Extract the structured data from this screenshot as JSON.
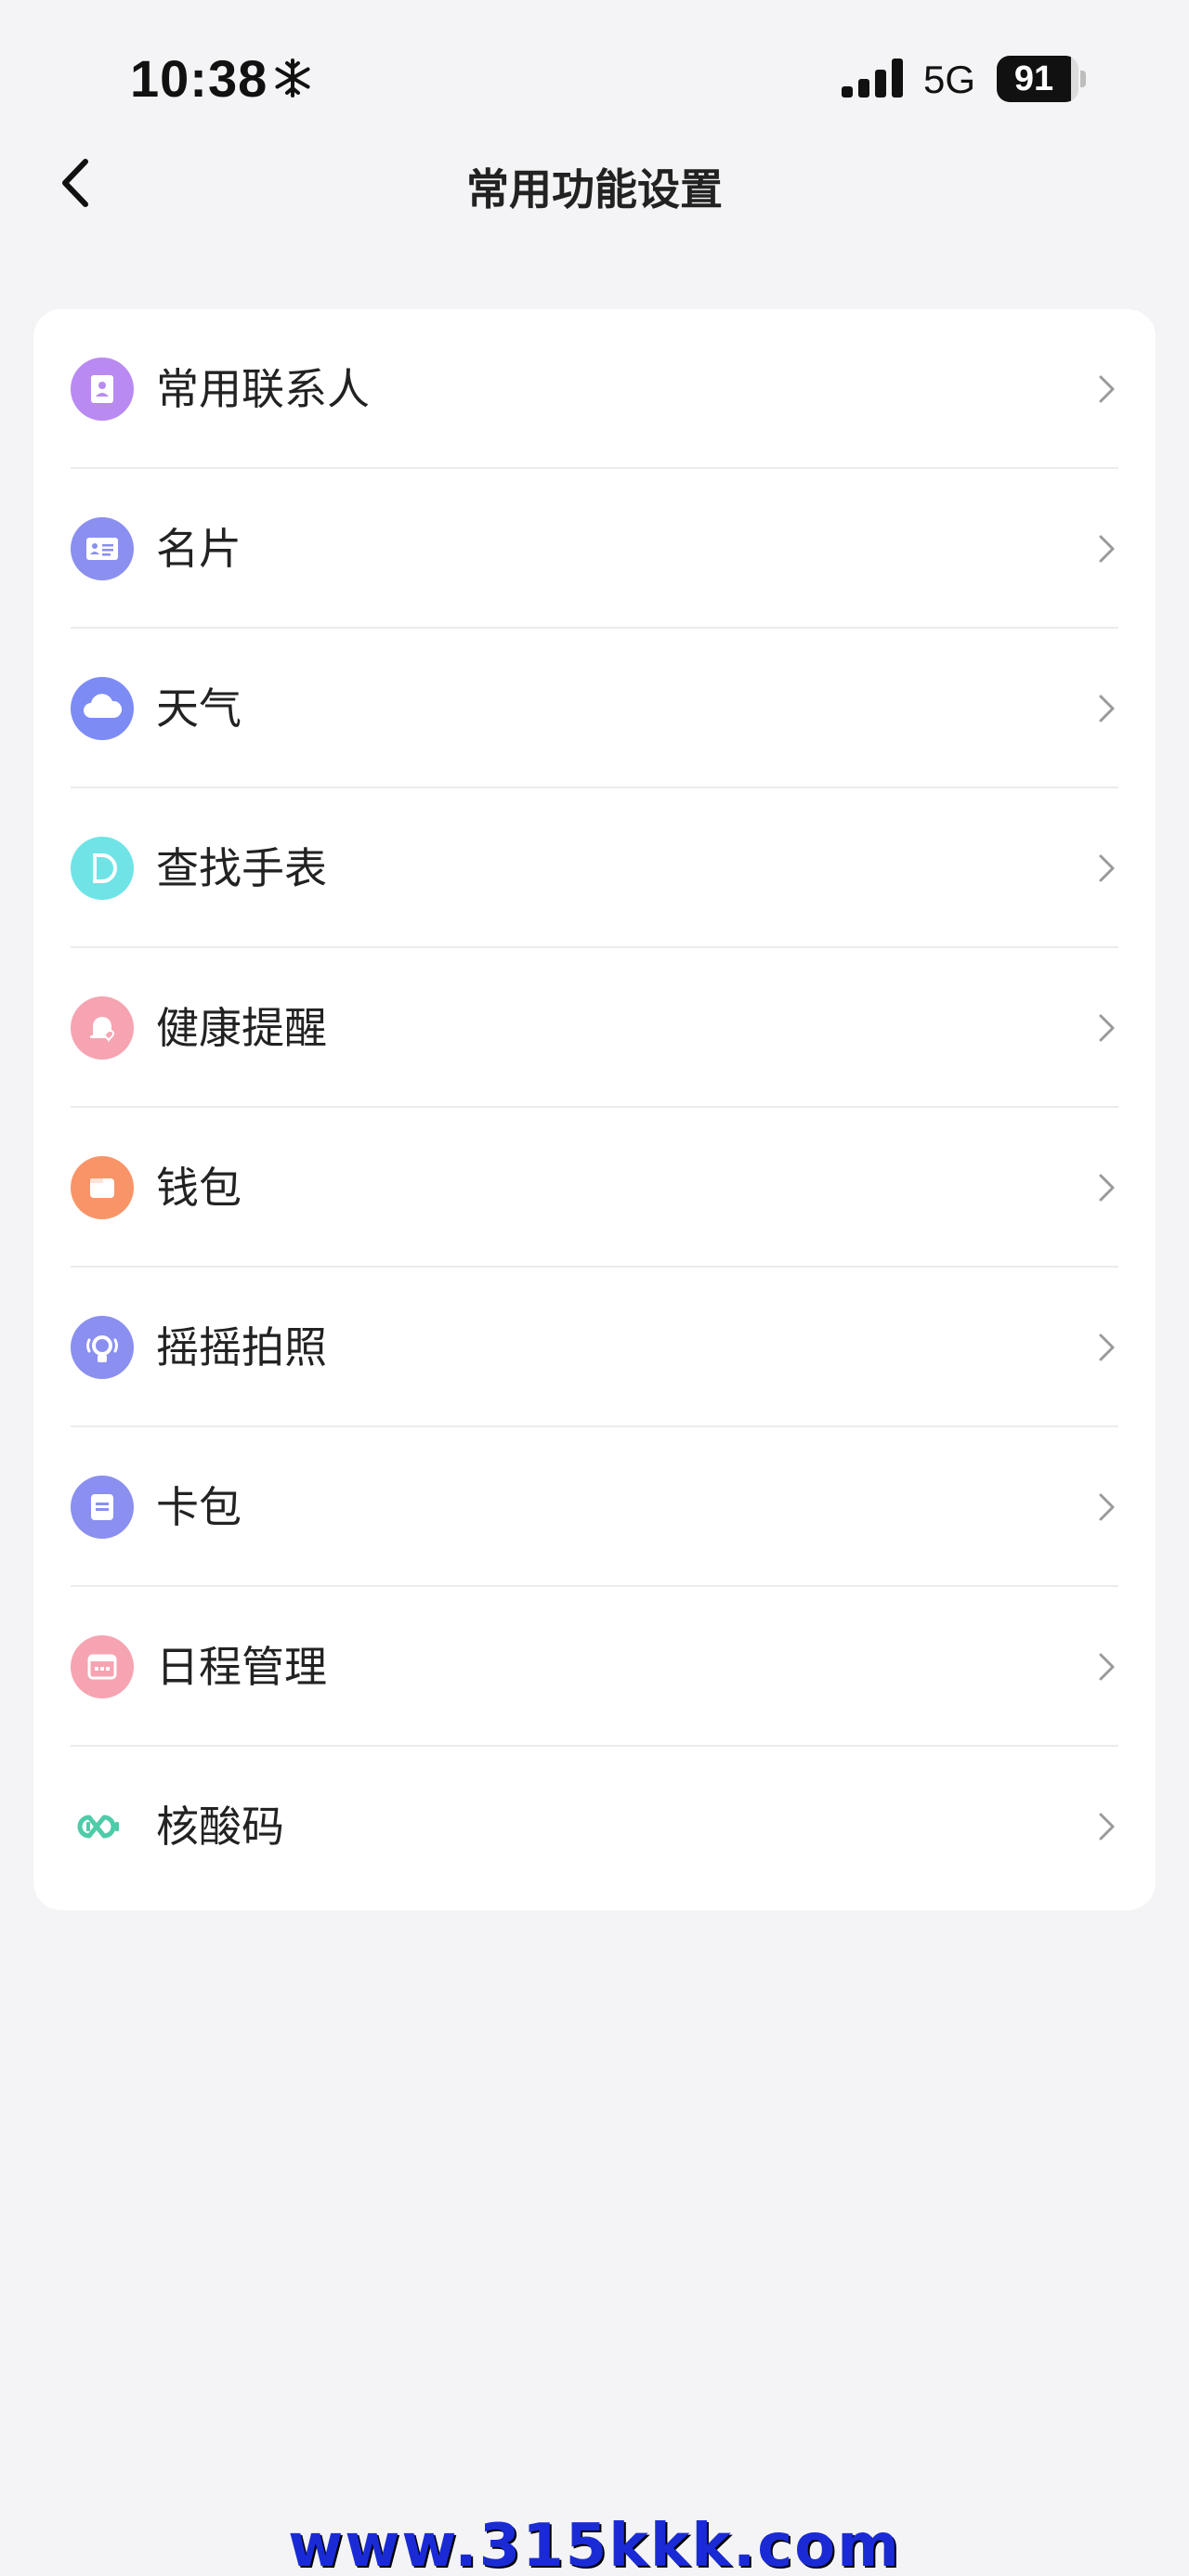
{
  "status_bar": {
    "time": "10:38",
    "network": "5G",
    "battery": "91",
    "battery_fraction": 0.91
  },
  "nav": {
    "title": "常用功能设置"
  },
  "colors": {
    "contacts": "#b98af2",
    "card": "#8a8ff0",
    "weather": "#7d8bf5",
    "find_watch": "#6fe3e6",
    "health": "#f6a4b2",
    "wallet": "#f99468",
    "shake": "#8a8ff0",
    "card_pack": "#8a8ff0",
    "schedule": "#f6a4b2",
    "nucleic": "#4ecba8"
  },
  "items": [
    {
      "label": "常用联系人",
      "icon": "contacts-icon"
    },
    {
      "label": "名片",
      "icon": "business-card-icon"
    },
    {
      "label": "天气",
      "icon": "cloud-icon"
    },
    {
      "label": "查找手表",
      "icon": "find-watch-icon"
    },
    {
      "label": "健康提醒",
      "icon": "health-reminder-icon"
    },
    {
      "label": "钱包",
      "icon": "wallet-icon"
    },
    {
      "label": "摇摇拍照",
      "icon": "shake-camera-icon"
    },
    {
      "label": "卡包",
      "icon": "card-pack-icon"
    },
    {
      "label": "日程管理",
      "icon": "calendar-icon"
    },
    {
      "label": "核酸码",
      "icon": "nucleic-code-icon"
    }
  ],
  "watermark": "www.315kkk.com"
}
